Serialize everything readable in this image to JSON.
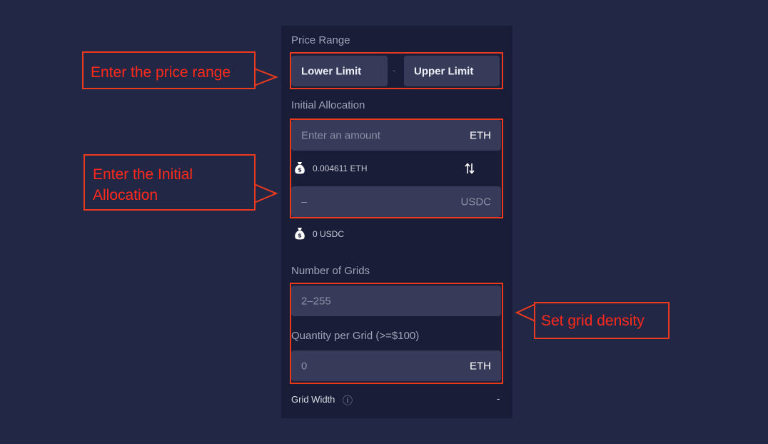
{
  "price_range": {
    "label": "Price Range",
    "lower_placeholder": "Lower Limit",
    "separator": "-",
    "upper_placeholder": "Upper Limit"
  },
  "initial_allocation": {
    "label": "Initial Allocation",
    "amount_placeholder": "Enter an amount",
    "amount_unit": "ETH",
    "eth_balance": "0.004611 ETH",
    "swap_icon": "swap-arrows-icon",
    "usdc_value": "–",
    "usdc_unit": "USDC",
    "usdc_balance": "0 USDC"
  },
  "grids": {
    "label": "Number of Grids",
    "placeholder": "2–255"
  },
  "quantity": {
    "label": "Quantity per Grid (>=$100)",
    "placeholder": "0",
    "unit": "ETH"
  },
  "grid_width": {
    "label": "Grid Width",
    "info_icon": "ⓘ",
    "value": "-"
  },
  "annotations": {
    "price_range": "Enter the price range",
    "initial_allocation_line1": "Enter the Initial",
    "initial_allocation_line2": "Allocation",
    "grid_density": "Set grid density",
    "color": "#ee3a1c"
  }
}
